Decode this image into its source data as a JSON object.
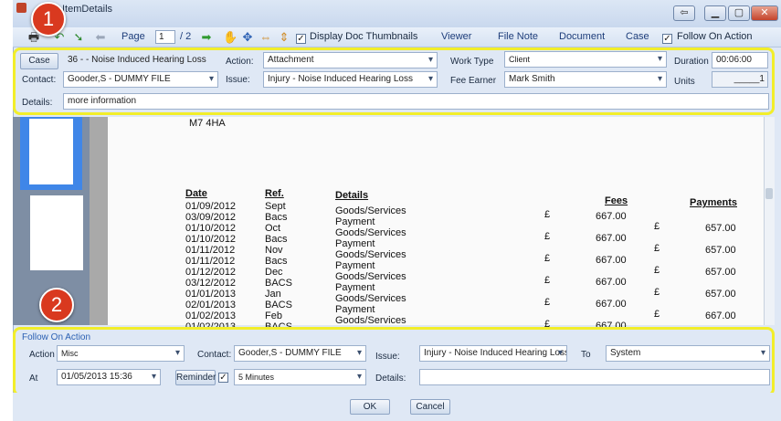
{
  "window": {
    "title": "ItemDetails",
    "buttons": [
      "⇦",
      "▁",
      "▢",
      "✕"
    ]
  },
  "toolbar": {
    "page_label": "Page",
    "page_value": "1",
    "page_total": "/ 2",
    "display_thumbnails": "Display Doc Thumbnails",
    "viewer": "Viewer",
    "file_note": "File Note",
    "document": "Document",
    "case": "Case",
    "follow_on_action": "Follow On Action"
  },
  "details": {
    "case_button": "Case",
    "case_value": "36 -  - Noise Induced Hearing Loss",
    "contact_label": "Contact:",
    "contact_value": "Gooder,S - DUMMY FILE",
    "action_label": "Action:",
    "action_value": "Attachment",
    "issue_label": "Issue:",
    "issue_value": "Injury - Noise Induced Hearing Loss",
    "work_type_label": "Work Type",
    "work_type_value": "Client",
    "fee_earner_label": "Fee Earner",
    "fee_earner_value": "Mark Smith",
    "duration_label": "Duration",
    "duration_value": "00:06:00",
    "units_label": "Units",
    "units_value": "_____1",
    "details_label": "Details:",
    "details_value": "more information"
  },
  "document": {
    "address_line": "M7 4HA",
    "headers": {
      "date": "Date",
      "ref": "Ref.",
      "details": "Details",
      "fees": "Fees",
      "payments": "Payments"
    },
    "rows": [
      {
        "date": "01/09/2012",
        "ref": "Sept",
        "details": "Goods/Services"
      },
      {
        "date": "03/09/2012",
        "ref": "Bacs",
        "details": "Payment"
      },
      {
        "date": "01/10/2012",
        "ref": "Oct",
        "details": "Goods/Services"
      },
      {
        "date": "01/10/2012",
        "ref": "Bacs",
        "details": "Payment"
      },
      {
        "date": "01/11/2012",
        "ref": "Nov",
        "details": "Goods/Services"
      },
      {
        "date": "01/11/2012",
        "ref": "Bacs",
        "details": "Payment"
      },
      {
        "date": "01/12/2012",
        "ref": "Dec",
        "details": "Goods/Services"
      },
      {
        "date": "03/12/2012",
        "ref": "BACS",
        "details": "Payment"
      },
      {
        "date": "01/01/2013",
        "ref": "Jan",
        "details": "Goods/Services"
      },
      {
        "date": "02/01/2013",
        "ref": "BACS",
        "details": "Payment"
      },
      {
        "date": "01/02/2013",
        "ref": "Feb",
        "details": "Goods/Services"
      },
      {
        "date": "01/02/2013",
        "ref": "BACS",
        "details": ""
      }
    ],
    "currency": "£",
    "fees": [
      "667.00",
      "667.00",
      "667.00",
      "667.00",
      "667.00",
      "667.00"
    ],
    "payments": [
      "657.00",
      "657.00",
      "657.00",
      "657.00",
      "667.00"
    ]
  },
  "follow_on": {
    "header": "Follow On Action",
    "action_label": "Action",
    "action_value": "Misc",
    "contact_label": "Contact:",
    "contact_value": "Gooder,S - DUMMY FILE",
    "issue_label": "Issue:",
    "issue_value": "Injury - Noise Induced Hearing Loss",
    "to_label": "To",
    "to_value": "System",
    "at_label": "At",
    "at_value": "01/05/2013 15:36",
    "reminder_label": "Reminder",
    "reminder_value": "5 Minutes",
    "details_label": "Details:",
    "details_value": ""
  },
  "footer": {
    "ok": "OK",
    "cancel": "Cancel"
  },
  "callouts": [
    "1",
    "2"
  ],
  "colors": {
    "highlight": "#f2ee2a",
    "badge": "#d9391f",
    "thumb_selected": "#3f86e8"
  }
}
